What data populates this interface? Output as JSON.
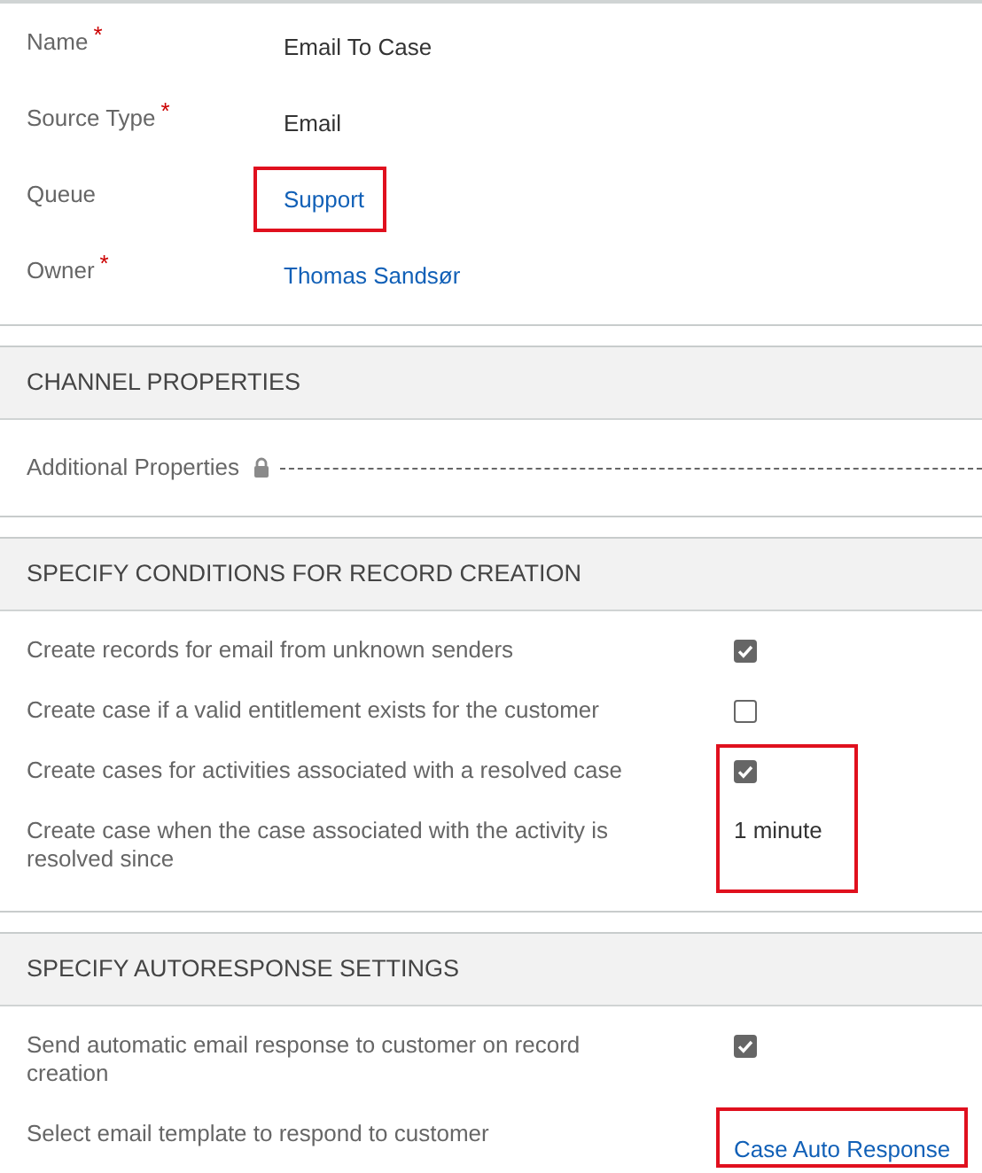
{
  "general": {
    "fields": [
      {
        "label": "Name",
        "required_mark": "*",
        "value": {
          "kind": "text",
          "text": "Email To Case"
        }
      },
      {
        "label": "Source Type",
        "required_mark": "*",
        "value": {
          "kind": "text",
          "text": "Email"
        }
      },
      {
        "label": "Queue",
        "value": {
          "kind": "link",
          "text": "Support"
        },
        "highlighted": true
      },
      {
        "label": "Owner",
        "required_mark": "*",
        "value": {
          "kind": "link",
          "text": "Thomas Sandsør"
        }
      }
    ]
  },
  "sections": [
    {
      "title": "CHANNEL PROPERTIES",
      "rows": [
        {
          "label": "Additional Properties",
          "value": {
            "kind": "locked"
          }
        }
      ]
    },
    {
      "title": "SPECIFY CONDITIONS FOR RECORD CREATION",
      "rows": [
        {
          "label": "Create records for email from unknown senders",
          "value": {
            "kind": "checkbox",
            "checked": true
          }
        },
        {
          "label": "Create case if a valid entitlement exists for the customer",
          "value": {
            "kind": "checkbox",
            "checked": false
          }
        },
        {
          "label": "Create cases for activities associated with a resolved case",
          "value": {
            "kind": "checkbox",
            "checked": true
          },
          "highlighted": true
        },
        {
          "label": "Create case when the case associated with the activity is resolved since",
          "value": {
            "kind": "text",
            "text": "1 minute"
          },
          "highlighted": true
        }
      ]
    },
    {
      "title": "SPECIFY AUTORESPONSE SETTINGS",
      "rows": [
        {
          "label": "Send automatic email response to customer on record creation",
          "value": {
            "kind": "checkbox",
            "checked": true
          }
        },
        {
          "label": "Select email template to respond to customer",
          "value": {
            "kind": "link",
            "text": "Case Auto Response"
          },
          "highlighted": true
        }
      ]
    }
  ]
}
